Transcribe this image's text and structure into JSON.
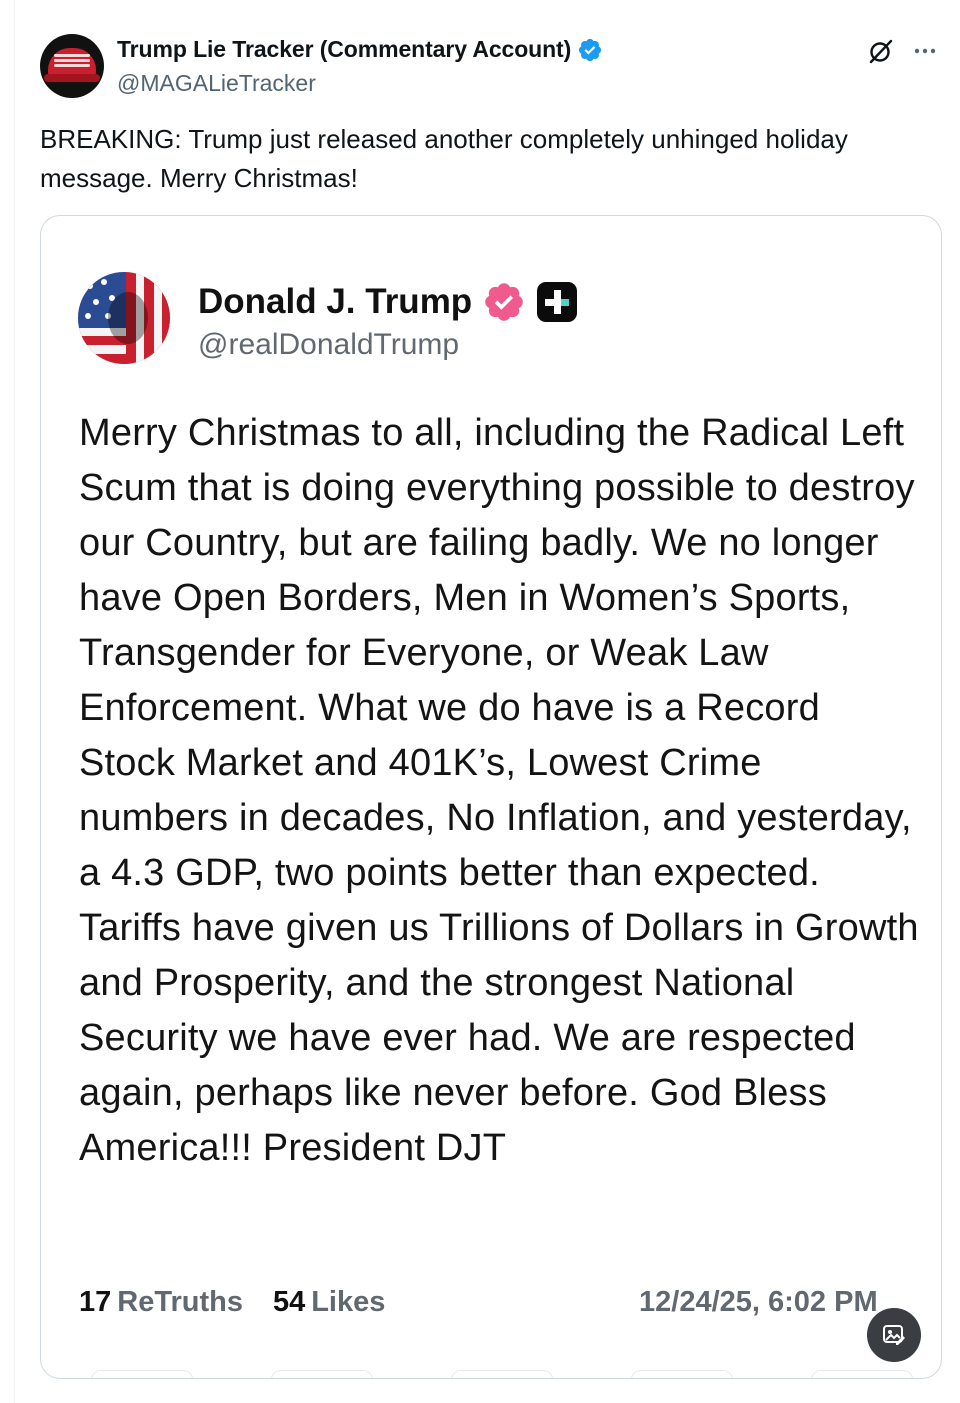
{
  "account": {
    "display_name": "Trump Lie Tracker (Commentary Account)",
    "handle": "@MAGALieTracker",
    "avatar_icon": "red-maga-hat-avatar",
    "verified_icon": "blue-verified-badge-icon"
  },
  "tweet": {
    "text": "BREAKING: Trump just released another completely unhinged holiday message. Merry Christmas!"
  },
  "embedded_post": {
    "display_name": "Donald J. Trump",
    "handle": "@realDonaldTrump",
    "avatar_icon": "flag-portrait-avatar",
    "badges": [
      "pink-verified-badge-icon",
      "truth-plus-badge-icon"
    ],
    "body": "Merry Christmas to all, including the Radical Left Scum that is doing everything possible to destroy our Country, but are failing badly. We no longer have Open Borders, Men in Women’s Sports, Transgender for Everyone, or Weak Law Enforcement. What we do have is a Record Stock Market and 401K’s, Lowest Crime numbers in decades, No Inflation, and yesterday, a 4.3 GDP, two points better than expected. Tariffs have given us Trillions of Dollars in Growth and Prosperity, and the strongest National Security we have ever had. We are respected again, perhaps like never before. God Bless America!!! President DJT",
    "stats": {
      "retruths_count": "17",
      "retruths_label": "ReTruths",
      "likes_count": "54",
      "likes_label": "Likes"
    },
    "timestamp": "12/24/25, 6:02 PM"
  },
  "colors": {
    "verified_blue": "#1d9bf0",
    "truth_pink": "#f05a8d",
    "secondary_text": "#536471"
  }
}
